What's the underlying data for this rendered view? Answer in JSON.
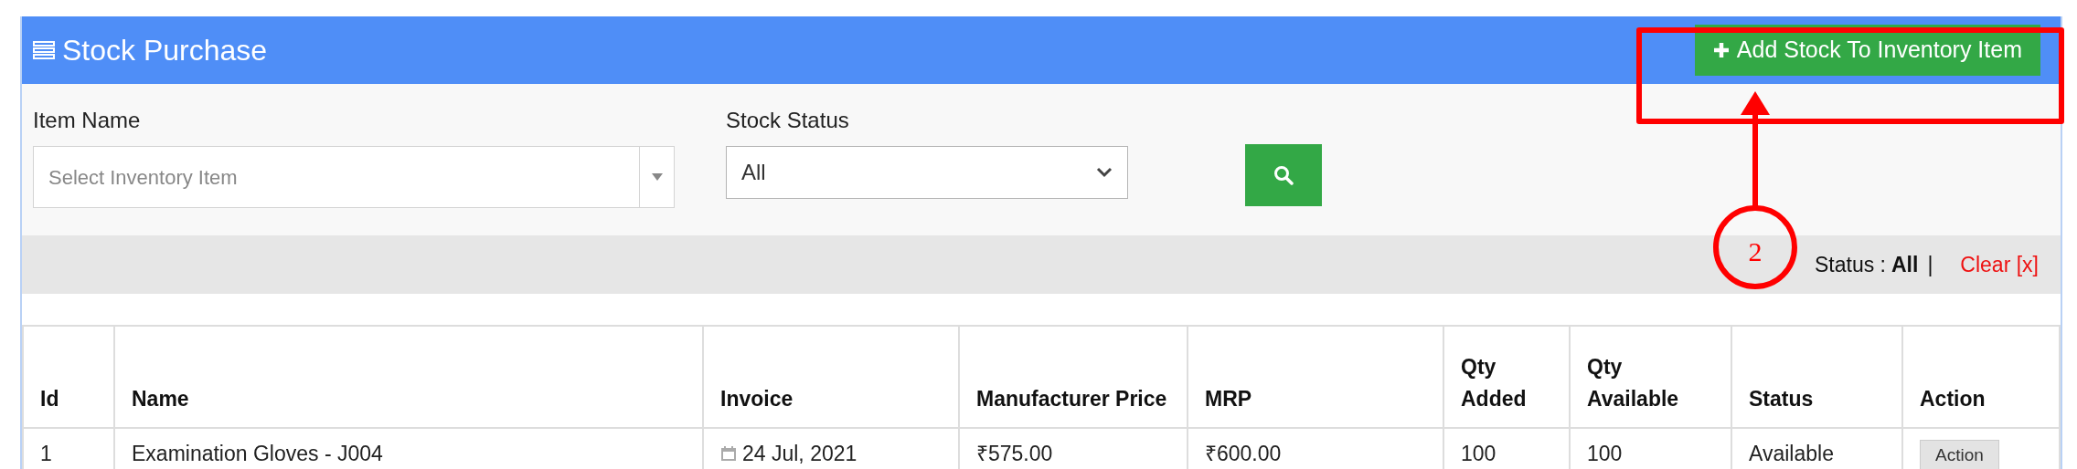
{
  "panel": {
    "title": "Stock Purchase",
    "add_button": "Add Stock To Inventory Item"
  },
  "filters": {
    "item_name": {
      "label": "Item Name",
      "placeholder": "Select Inventory Item"
    },
    "stock_status": {
      "label": "Stock Status",
      "value": "All"
    }
  },
  "status_bar": {
    "label": "Status :",
    "value": "All",
    "separator": "|",
    "clear": "Clear [x]"
  },
  "table": {
    "columns": [
      "Id",
      "Name",
      "Invoice",
      "Manufacturer Price",
      "MRP",
      "Qty Added",
      "Qty Available",
      "Status",
      "Action"
    ],
    "rows": [
      {
        "id": "1",
        "name": "Examination Gloves - J004",
        "invoice": "24 Jul, 2021",
        "manufacturer_price": "₹575.00",
        "mrp": "₹600.00",
        "qty_added": "100",
        "qty_available": "100",
        "status": "Available",
        "action": "Action"
      }
    ]
  },
  "annotation": {
    "label": "2"
  }
}
